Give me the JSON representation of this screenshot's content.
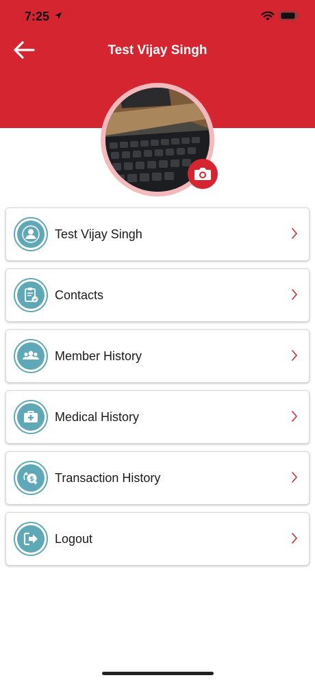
{
  "status_bar": {
    "time": "7:25"
  },
  "header": {
    "title": "Test Vijay Singh"
  },
  "menu": {
    "items": [
      {
        "label": "Test Vijay Singh",
        "icon": "user-icon"
      },
      {
        "label": "Contacts",
        "icon": "clipboard-check-icon"
      },
      {
        "label": "Member History",
        "icon": "group-icon"
      },
      {
        "label": "Medical History",
        "icon": "medical-kit-icon"
      },
      {
        "label": "Transaction History",
        "icon": "money-transfer-icon"
      },
      {
        "label": "Logout",
        "icon": "logout-icon"
      }
    ]
  },
  "colors": {
    "brand_red": "#d42530",
    "icon_teal": "#5fa8b8",
    "avatar_ring": "#f3b9bd"
  }
}
